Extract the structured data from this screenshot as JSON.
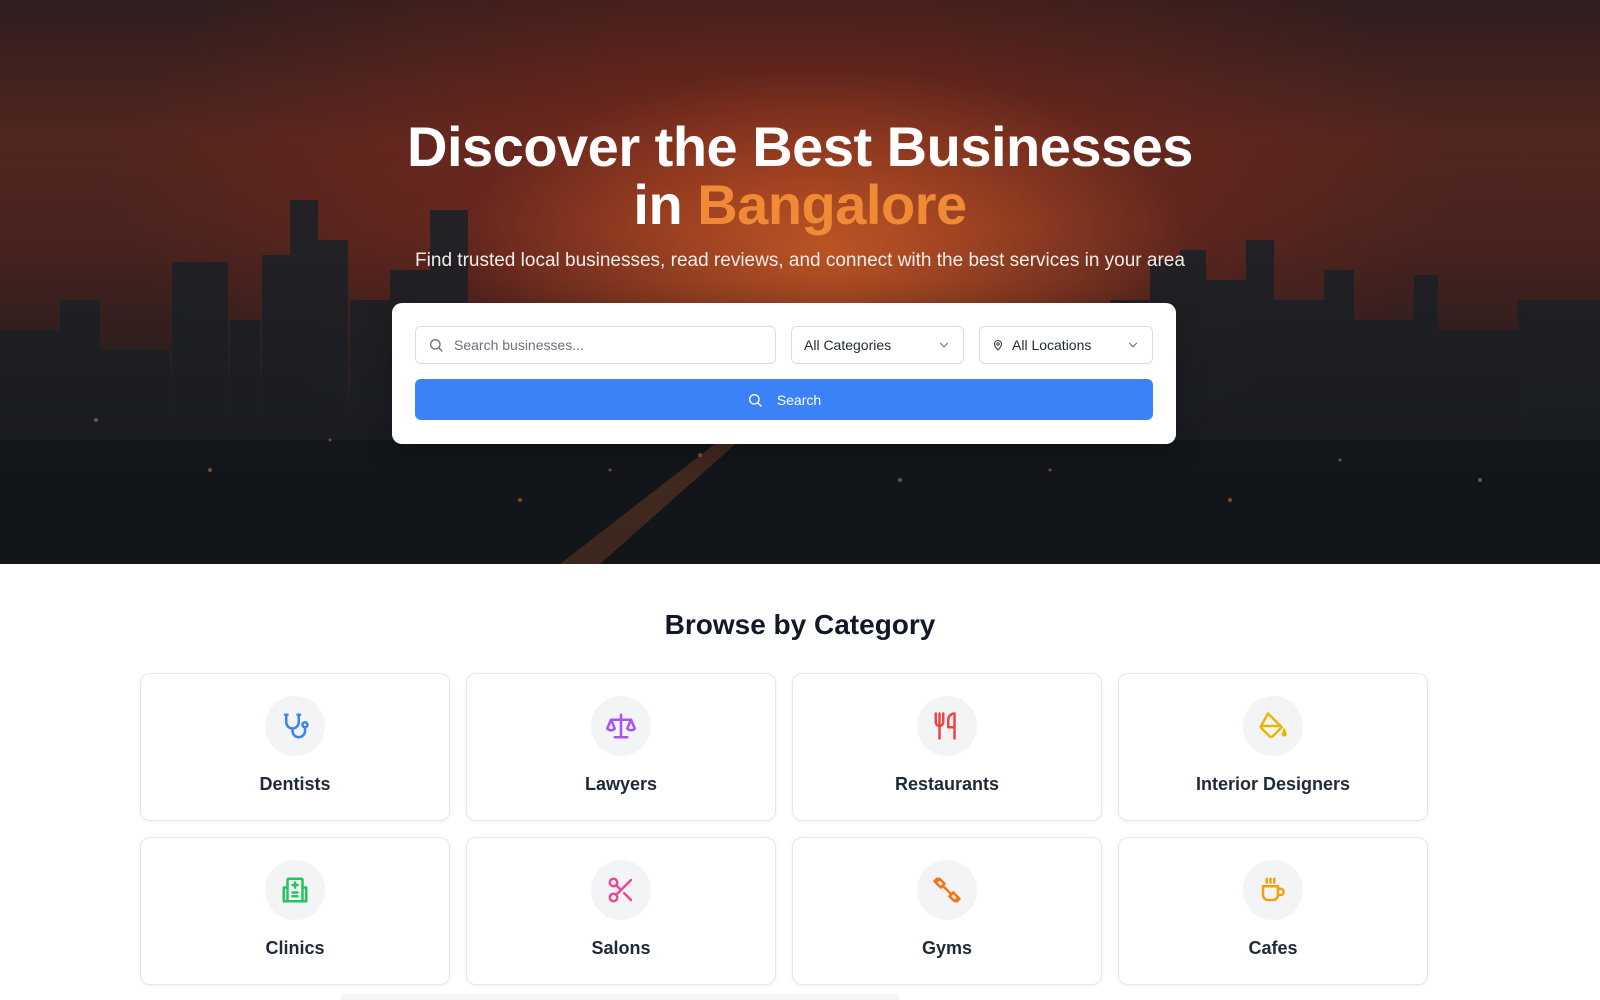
{
  "hero": {
    "title_line1": "Discover the Best Businesses",
    "title_in": "in",
    "title_city": "Bangalore",
    "subtitle": "Find trusted local businesses, read reviews, and connect with the best services in your area"
  },
  "search": {
    "placeholder": "Search businesses...",
    "category_value": "All Categories",
    "location_value": "All Locations",
    "button_label": "Search"
  },
  "browse": {
    "title": "Browse by Category",
    "categories": [
      {
        "label": "Dentists",
        "icon": "stethoscope-icon",
        "color": "#3b82f6"
      },
      {
        "label": "Lawyers",
        "icon": "scale-icon",
        "color": "#a855f7"
      },
      {
        "label": "Restaurants",
        "icon": "utensils-icon",
        "color": "#ef4444"
      },
      {
        "label": "Interior Designers",
        "icon": "paint-bucket-icon",
        "color": "#eab308"
      },
      {
        "label": "Clinics",
        "icon": "hospital-building-icon",
        "color": "#22c55e"
      },
      {
        "label": "Salons",
        "icon": "scissors-icon",
        "color": "#ec4899"
      },
      {
        "label": "Gyms",
        "icon": "dumbbell-icon",
        "color": "#f97316"
      },
      {
        "label": "Cafes",
        "icon": "coffee-icon",
        "color": "#f59e0b"
      }
    ]
  },
  "colors": {
    "accent": "#f08a36",
    "primary_button": "#3b82f6"
  }
}
